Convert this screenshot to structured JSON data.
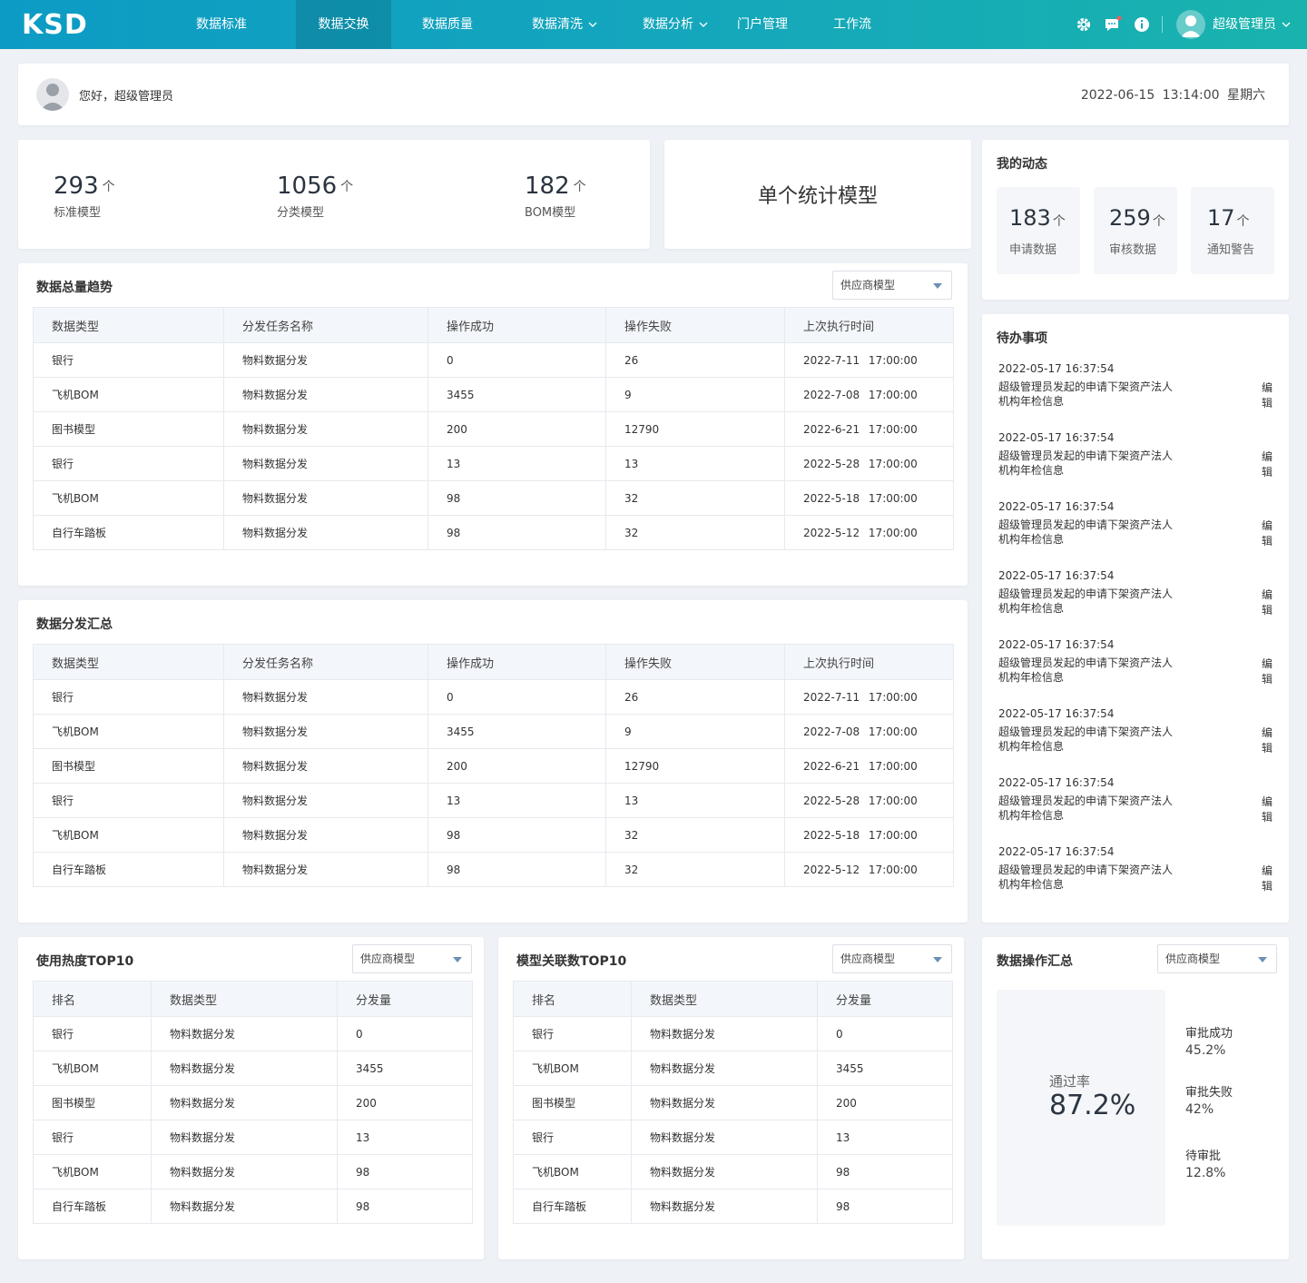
{
  "nav": {
    "logo": "KSD",
    "items": [
      {
        "label": "数据标准",
        "caret": false
      },
      {
        "label": "数据交换",
        "caret": false,
        "active": true
      },
      {
        "label": "数据质量",
        "caret": false
      },
      {
        "label": "数据清洗",
        "caret": true
      },
      {
        "label": "数据分析",
        "caret": true
      },
      {
        "label": "门户管理",
        "caret": false
      },
      {
        "label": "工作流",
        "caret": false
      }
    ],
    "user": "超级管理员",
    "icons": [
      "gear-icon",
      "message-icon",
      "info-icon",
      "avatar-icon",
      "chevron-down-icon"
    ]
  },
  "greeting": {
    "text": "您好，超级管理员",
    "datetime": "2022-06-15  13:14:00  星期六"
  },
  "stats": [
    {
      "value": "293",
      "label": "标准模型"
    },
    {
      "value": "1056",
      "label": "分类模型"
    },
    {
      "value": "182",
      "label": "BOM模型"
    }
  ],
  "arrow": "个",
  "single_model": "单个统计模型",
  "dynamics": {
    "title": "我的动态",
    "items": [
      {
        "value": "183",
        "label": "申请数据"
      },
      {
        "value": "259",
        "label": "审核数据"
      },
      {
        "value": "17",
        "label": "通知警告"
      }
    ]
  },
  "trend": {
    "title": "数据总量趋势",
    "select": "供应商模型",
    "headers": [
      "数据类型",
      "分发任务名称",
      "操作成功",
      "操作失败",
      "上次执行时间"
    ],
    "rows": [
      [
        "银行",
        "物料数据分发",
        "0",
        "26",
        "2022-7-11  17:00:00"
      ],
      [
        "飞机BOM",
        "物料数据分发",
        "3455",
        "9",
        "2022-7-08  17:00:00"
      ],
      [
        "图书模型",
        "物料数据分发",
        "200",
        "12790",
        "2022-6-21  17:00:00"
      ],
      [
        "银行",
        "物料数据分发",
        "13",
        "13",
        "2022-5-28  17:00:00"
      ],
      [
        "飞机BOM",
        "物料数据分发",
        "98",
        "32",
        "2022-5-18  17:00:00"
      ],
      [
        "自行车踏板",
        "物料数据分发",
        "98",
        "32",
        "2022-5-12  17:00:00"
      ]
    ]
  },
  "distribution": {
    "title": "数据分发汇总",
    "headers": [
      "数据类型",
      "分发任务名称",
      "操作成功",
      "操作失败",
      "上次执行时间"
    ],
    "rows": [
      [
        "银行",
        "物料数据分发",
        "0",
        "26",
        "2022-7-11  17:00:00"
      ],
      [
        "飞机BOM",
        "物料数据分发",
        "3455",
        "9",
        "2022-7-08  17:00:00"
      ],
      [
        "图书模型",
        "物料数据分发",
        "200",
        "12790",
        "2022-6-21  17:00:00"
      ],
      [
        "银行",
        "物料数据分发",
        "13",
        "13",
        "2022-5-28  17:00:00"
      ],
      [
        "飞机BOM",
        "物料数据分发",
        "98",
        "32",
        "2022-5-18  17:00:00"
      ],
      [
        "自行车踏板",
        "物料数据分发",
        "98",
        "32",
        "2022-5-12  17:00:00"
      ]
    ]
  },
  "todo": {
    "title": "待办事项",
    "edit_label": "编辑",
    "items": [
      {
        "time": "2022-05-17 16:37:54",
        "text": "超级管理员发起的申请下架资产法人机构年检信息"
      },
      {
        "time": "2022-05-17 16:37:54",
        "text": "超级管理员发起的申请下架资产法人机构年检信息"
      },
      {
        "time": "2022-05-17 16:37:54",
        "text": "超级管理员发起的申请下架资产法人机构年检信息"
      },
      {
        "time": "2022-05-17 16:37:54",
        "text": "超级管理员发起的申请下架资产法人机构年检信息"
      },
      {
        "time": "2022-05-17 16:37:54",
        "text": "超级管理员发起的申请下架资产法人机构年检信息"
      },
      {
        "time": "2022-05-17 16:37:54",
        "text": "超级管理员发起的申请下架资产法人机构年检信息"
      },
      {
        "time": "2022-05-17 16:37:54",
        "text": "超级管理员发起的申请下架资产法人机构年检信息"
      },
      {
        "time": "2022-05-17 16:37:54",
        "text": "超级管理员发起的申请下架资产法人机构年检信息"
      }
    ]
  },
  "heat_top10": {
    "title": "使用热度TOP10",
    "select": "供应商模型",
    "headers": [
      "排名",
      "数据类型",
      "分发量"
    ],
    "rows": [
      [
        "银行",
        "物料数据分发",
        "0"
      ],
      [
        "飞机BOM",
        "物料数据分发",
        "3455"
      ],
      [
        "图书模型",
        "物料数据分发",
        "200"
      ],
      [
        "银行",
        "物料数据分发",
        "13"
      ],
      [
        "飞机BOM",
        "物料数据分发",
        "98"
      ],
      [
        "自行车踏板",
        "物料数据分发",
        "98"
      ]
    ]
  },
  "relation_top10": {
    "title": "模型关联数TOP10",
    "select": "供应商模型",
    "headers": [
      "排名",
      "数据类型",
      "分发量"
    ],
    "rows": [
      [
        "银行",
        "物料数据分发",
        "0"
      ],
      [
        "飞机BOM",
        "物料数据分发",
        "3455"
      ],
      [
        "图书模型",
        "物料数据分发",
        "200"
      ],
      [
        "银行",
        "物料数据分发",
        "13"
      ],
      [
        "飞机BOM",
        "物料数据分发",
        "98"
      ],
      [
        "自行车踏板",
        "物料数据分发",
        "98"
      ]
    ]
  },
  "operations": {
    "title": "数据操作汇总",
    "select": "供应商模型",
    "rate_label": "通过率",
    "rate_value": "87.2%",
    "items": [
      {
        "label": "审批成功",
        "value": "45.2%"
      },
      {
        "label": "审批失败",
        "value": "42%"
      },
      {
        "label": "待审批",
        "value": "12.8%"
      }
    ]
  },
  "colors": {
    "nav_start": "#0c9bc4",
    "nav_end": "#19b3ad",
    "page_bg": "#eef1f6"
  }
}
